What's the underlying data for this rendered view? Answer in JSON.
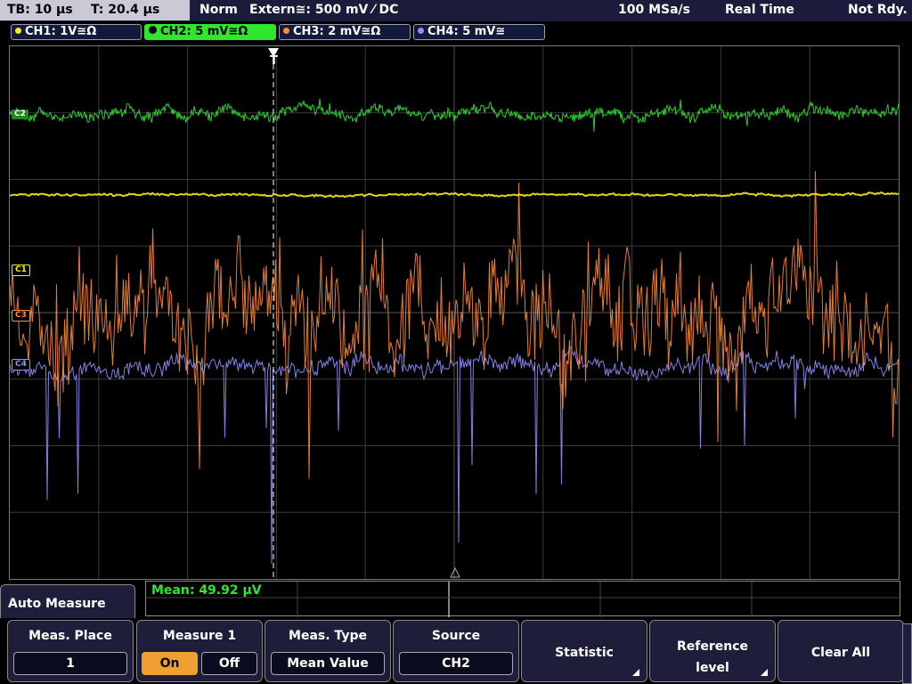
{
  "status": {
    "timebase": "TB: 10 µs",
    "trigger_time": "T: 20.4 µs",
    "mode": "Norm",
    "trigger_source": "Extern≅: 500 mV ⁄ DC",
    "sample_rate": "100 MSa/s",
    "acq_mode": "Real Time",
    "state": "Not Rdy."
  },
  "channels": [
    {
      "label": "CH1: 1V≅Ω",
      "color": "#ffeb1a",
      "marker": "C1"
    },
    {
      "label": "CH2: 5 mV≅Ω",
      "color": "#2ee62e",
      "marker": "C2"
    },
    {
      "label": "CH3: 2 mV≅Ω",
      "color": "#ff8a33",
      "marker": "C3"
    },
    {
      "label": "CH4: 5 mV≅",
      "color": "#8f8fff",
      "marker": "C4"
    }
  ],
  "trigger_marker": "T",
  "measurement": {
    "text": "Mean: 49.92 µV"
  },
  "menu": {
    "title": "Auto Measure"
  },
  "softkeys": {
    "meas_place": {
      "label": "Meas. Place",
      "value": "1"
    },
    "measure1": {
      "label": "Measure 1",
      "on": "On",
      "off": "Off"
    },
    "meas_type": {
      "label": "Meas. Type",
      "value": "Mean Value"
    },
    "source": {
      "label": "Source",
      "value": "CH2"
    },
    "statistic": {
      "label": "Statistic"
    },
    "reference": {
      "line1": "Reference",
      "line2": "level"
    },
    "clear_all": {
      "label": "Clear All"
    }
  },
  "colors": {
    "grid": "#3a3a3a",
    "accent_on": "#f0a030",
    "active_channel": "#2ee62e"
  }
}
